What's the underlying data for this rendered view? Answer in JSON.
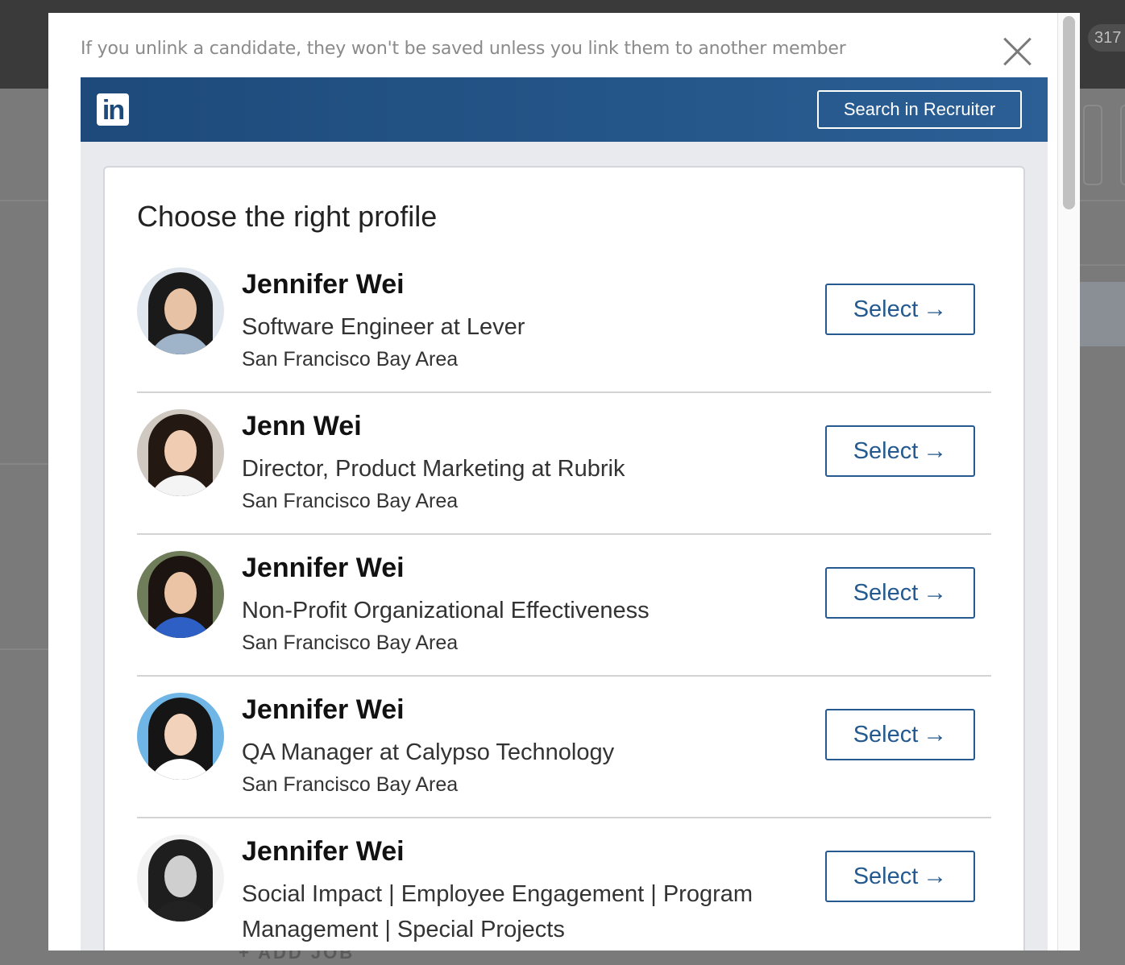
{
  "background": {
    "badge": "317",
    "add_job_label": "+ ADD JOB"
  },
  "modal": {
    "notice": "If you unlink a candidate, they won't be saved unless you link them to another member",
    "close_icon": "close-icon"
  },
  "linkedin": {
    "logo_text": "in",
    "search_button": "Search in Recruiter",
    "brand_color": "#1d4a7a"
  },
  "card": {
    "title": "Choose the right profile",
    "select_label": "Select",
    "select_arrow": "→",
    "profiles": [
      {
        "name": "Jennifer Wei",
        "title": "Software Engineer at Lever",
        "location": "San Francisco Bay Area"
      },
      {
        "name": "Jenn Wei",
        "title": "Director, Product Marketing at Rubrik",
        "location": "San Francisco Bay Area"
      },
      {
        "name": "Jennifer Wei",
        "title": "Non-Profit Organizational Effectiveness",
        "location": "San Francisco Bay Area"
      },
      {
        "name": "Jennifer Wei",
        "title": "QA Manager at Calypso Technology",
        "location": "San Francisco Bay Area"
      },
      {
        "name": "Jennifer Wei",
        "title": "Social Impact | Employee Engagement | Program Management | Special Projects",
        "location": ""
      }
    ]
  }
}
